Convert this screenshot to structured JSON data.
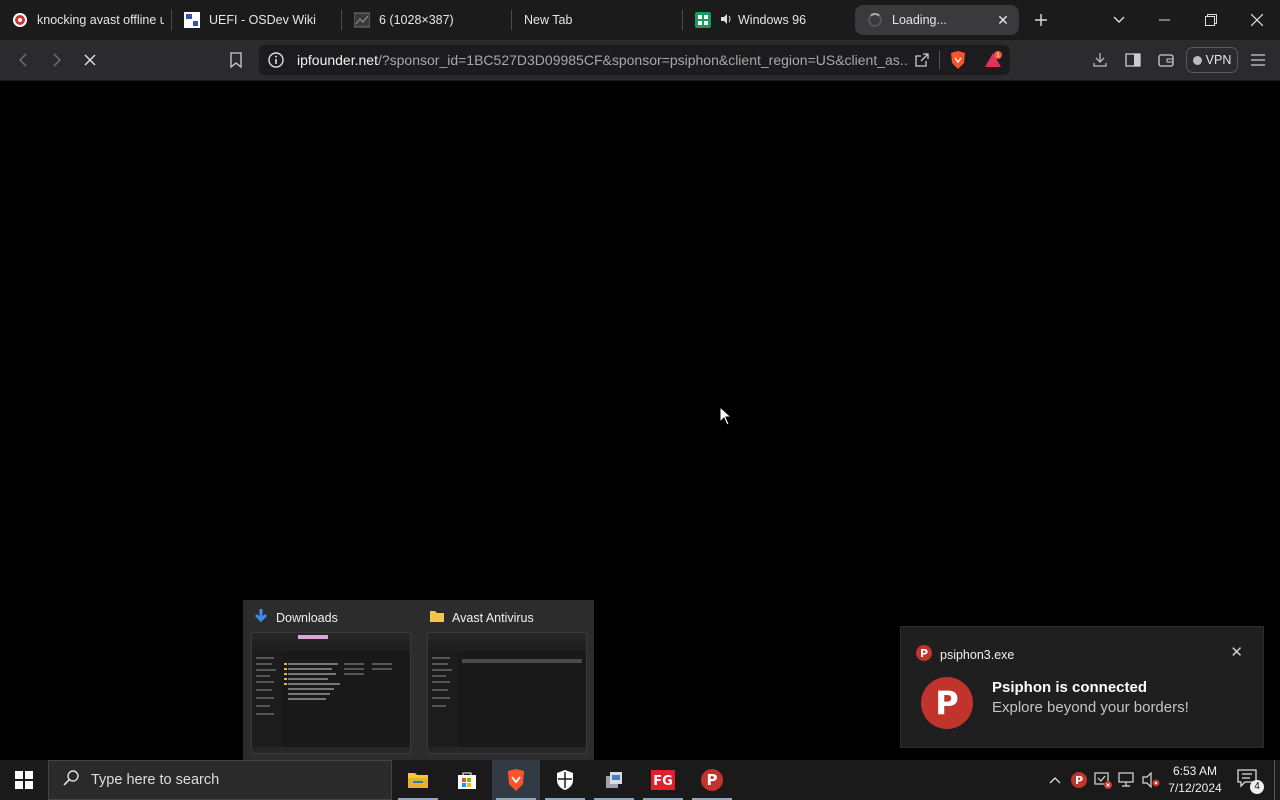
{
  "tabs": [
    {
      "title": "knocking avast offline u",
      "icon": "avast-favicon"
    },
    {
      "title": "UEFI - OSDev Wiki",
      "icon": "osdev-favicon"
    },
    {
      "title": "6 (1028×387)",
      "icon": "image-favicon"
    },
    {
      "title": "New Tab",
      "icon": ""
    },
    {
      "title": "Windows 96",
      "icon": "windows96-favicon",
      "audio": true
    },
    {
      "title": "Loading...",
      "icon": "spinner-icon",
      "active": true
    }
  ],
  "toolbar": {
    "url_host": "ipfounder.net",
    "url_rest": "/?sponsor_id=1BC527D3D09985CF&sponsor=psiphon&client_region=US&client_as...",
    "vpn_label": "VPN",
    "rewards_badge": "1"
  },
  "preview": [
    {
      "title": "Downloads",
      "icon": "download-arrow-icon"
    },
    {
      "title": "Avast Antivirus",
      "icon": "folder-icon"
    }
  ],
  "toast": {
    "app": "psiphon3.exe",
    "title": "Psiphon is connected",
    "body": "Explore beyond your borders!"
  },
  "taskbar": {
    "search_placeholder": "Type here to search",
    "time": "6:53 AM",
    "date": "7/12/2024",
    "notification_count": "4",
    "apps": [
      "file-explorer",
      "microsoft-store",
      "brave",
      "windows-security",
      "network-app",
      "fg-app",
      "psiphon"
    ]
  },
  "colors": {
    "brave_orange": "#fb542b",
    "psiphon_red": "#c0342b",
    "accent_blue": "#8aa8c8"
  }
}
